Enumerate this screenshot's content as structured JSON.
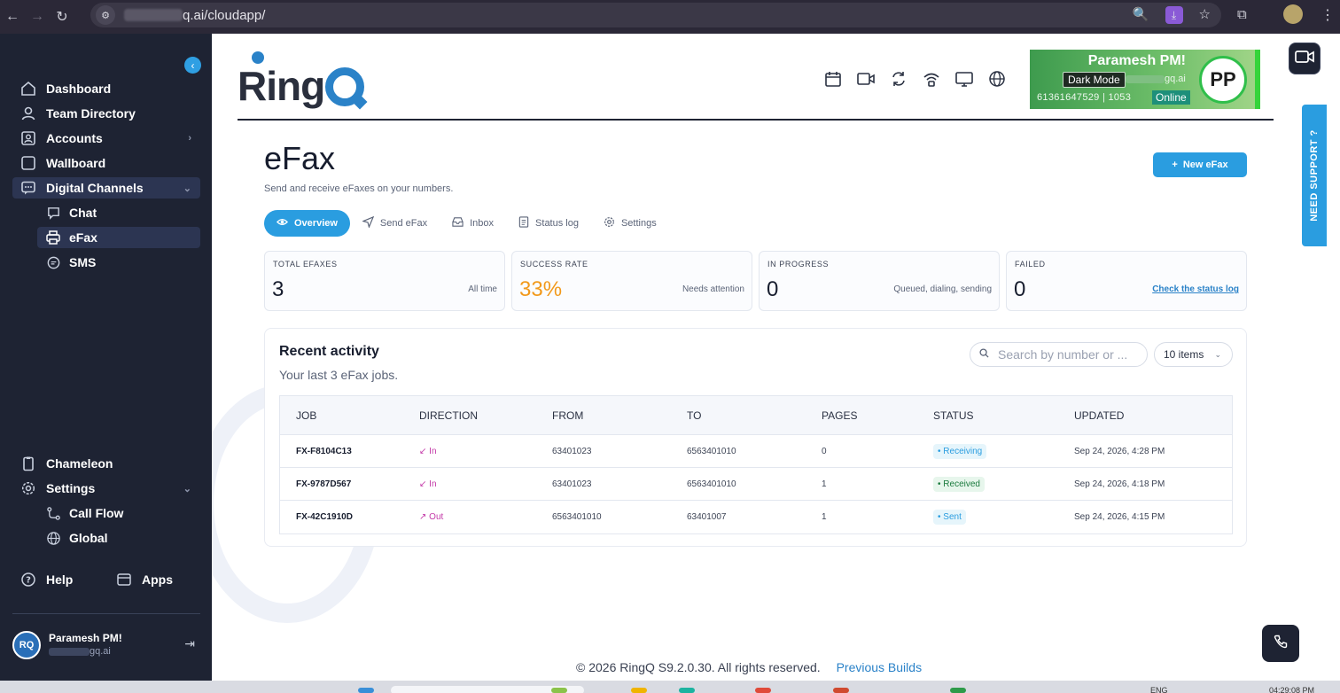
{
  "browser": {
    "url": "q.ai/cloudapp/"
  },
  "sidebar": {
    "nav": [
      {
        "label": "Dashboard",
        "icon": "home-icon"
      },
      {
        "label": "Team Directory",
        "icon": "person-icon"
      },
      {
        "label": "Accounts",
        "icon": "id-card-icon"
      },
      {
        "label": "Wallboard",
        "icon": "square-icon"
      },
      {
        "label": "Digital Channels",
        "icon": "chat-bubble-icon"
      }
    ],
    "sub": [
      {
        "label": "Chat",
        "icon": "chat-icon"
      },
      {
        "label": "eFax",
        "icon": "printer-icon"
      },
      {
        "label": "SMS",
        "icon": "sms-icon"
      }
    ],
    "bottom": [
      {
        "label": "Chameleon",
        "icon": "clipboard-icon"
      },
      {
        "label": "Settings",
        "icon": "gear-icon"
      }
    ],
    "settings_sub": [
      {
        "label": "Call Flow",
        "icon": "flow-icon"
      },
      {
        "label": "Global",
        "icon": "globe-icon"
      }
    ],
    "help_label": "Help",
    "apps_label": "Apps",
    "user_name": "Paramesh PM!",
    "user_email_suffix": "gq.ai",
    "avatar_initials": "RQ"
  },
  "header": {
    "logo_text": "Ring",
    "agent_name": "Paramesh PM!",
    "dark_mode_label": "Dark Mode",
    "domain_suffix": "gq.ai",
    "extension_info": "61361647529  |  1053",
    "status": "Online",
    "initials": "PP"
  },
  "page": {
    "title": "eFax",
    "subtitle": "Send and receive eFaxes on your numbers.",
    "new_button": "New eFax",
    "tabs": [
      {
        "label": "Overview",
        "icon": "eye-icon",
        "active": true
      },
      {
        "label": "Send eFax",
        "icon": "send-icon",
        "active": false
      },
      {
        "label": "Inbox",
        "icon": "inbox-icon",
        "active": false
      },
      {
        "label": "Status log",
        "icon": "document-icon",
        "active": false
      },
      {
        "label": "Settings",
        "icon": "gear-icon",
        "active": false
      }
    ]
  },
  "stats": [
    {
      "label": "TOTAL EFAXES",
      "value": "3",
      "note": "All time"
    },
    {
      "label": "SUCCESS RATE",
      "value": "33%",
      "note": "Needs attention"
    },
    {
      "label": "IN PROGRESS",
      "value": "0",
      "note": "Queued, dialing, sending"
    },
    {
      "label": "FAILED",
      "value": "0",
      "note": "Check the status log"
    }
  ],
  "activity": {
    "title": "Recent activity",
    "subtitle": "Your last 3 eFax jobs.",
    "search_placeholder": "Search by number or ...",
    "items_select": "10 items",
    "columns": [
      "JOB",
      "DIRECTION",
      "FROM",
      "TO",
      "PAGES",
      "STATUS",
      "UPDATED"
    ],
    "rows": [
      {
        "job": "FX-F8104C13",
        "direction": "In",
        "dir_icon": "arrow-down-left-icon",
        "from": "63401023",
        "to": "6563401010",
        "pages": "0",
        "status": "Receiving",
        "updated": "Sep 24, 2026, 4:28 PM"
      },
      {
        "job": "FX-9787D567",
        "direction": "In",
        "dir_icon": "arrow-down-left-icon",
        "from": "63401023",
        "to": "6563401010",
        "pages": "1",
        "status": "Received",
        "updated": "Sep 24, 2026, 4:18 PM"
      },
      {
        "job": "FX-42C1910D",
        "direction": "Out",
        "dir_icon": "arrow-up-right-icon",
        "from": "6563401010",
        "to": "63401007",
        "pages": "1",
        "status": "Sent",
        "updated": "Sep 24, 2026, 4:15 PM"
      }
    ]
  },
  "footer": {
    "copyright": "© 2026 RingQ S9.2.0.30. All rights reserved.",
    "previous_builds": "Previous Builds"
  },
  "support_label": "NEED SUPPORT ?",
  "taskbar": {
    "lang": "ENG",
    "time": "04:29:08 PM"
  }
}
